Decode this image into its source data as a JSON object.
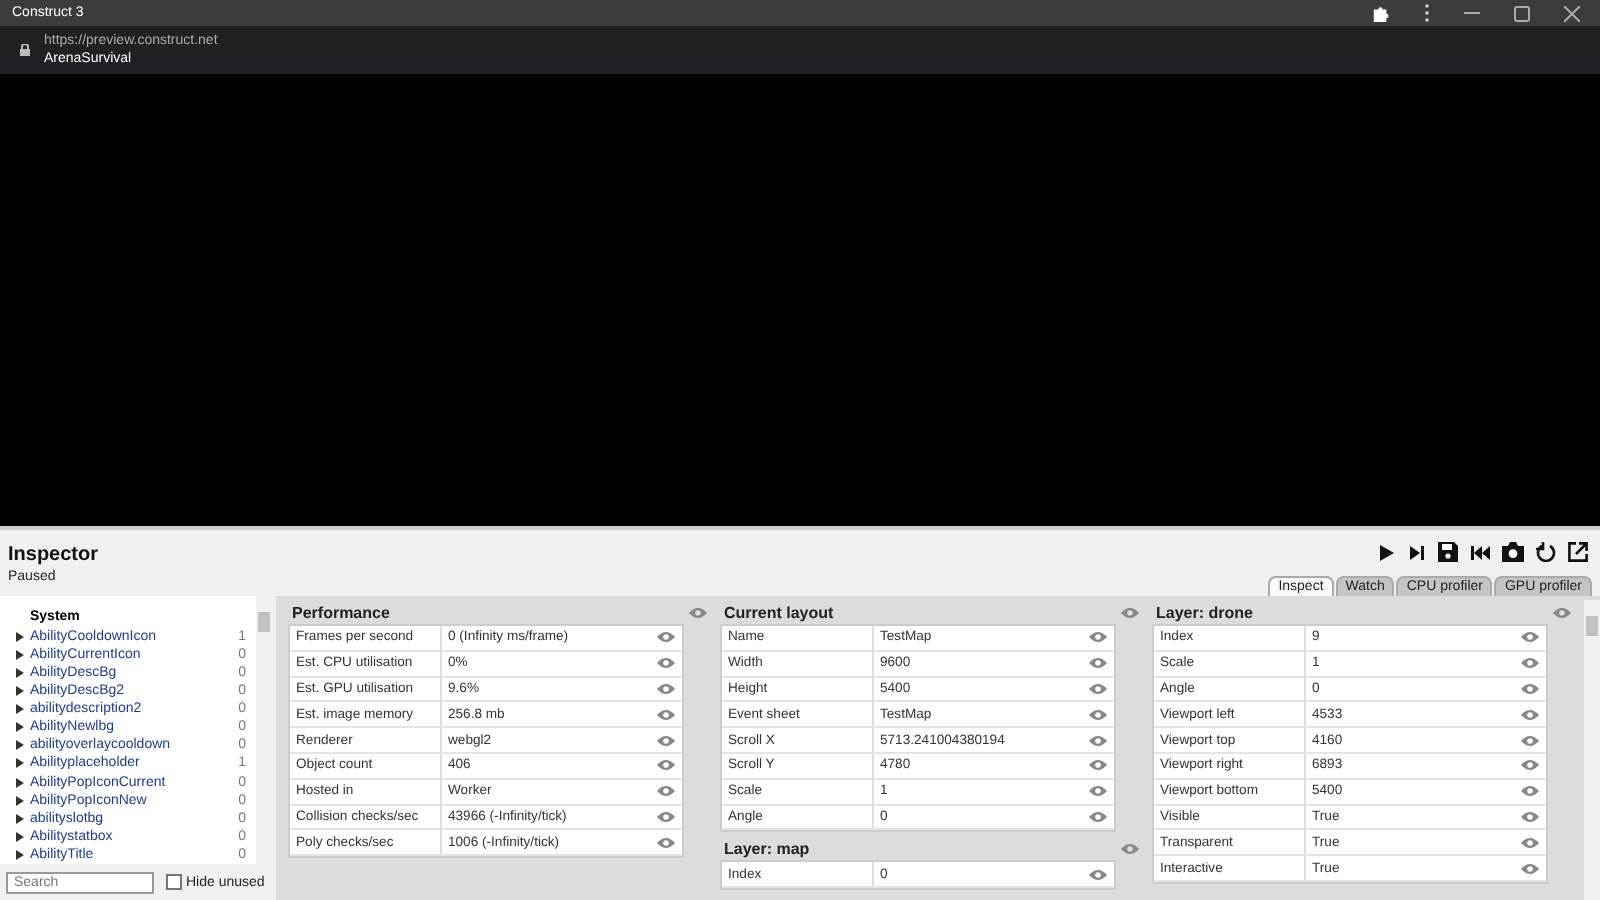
{
  "window": {
    "title": "Construct 3"
  },
  "address_bar": {
    "url": "https://preview.construct.net",
    "page_title": "ArenaSurvival"
  },
  "inspector": {
    "title": "Inspector",
    "status": "Paused",
    "toolbar": [
      {
        "kind": "play"
      },
      {
        "kind": "step"
      },
      {
        "kind": "save"
      },
      {
        "kind": "rewind"
      },
      {
        "kind": "camera"
      },
      {
        "kind": "restart"
      },
      {
        "kind": "popout"
      }
    ],
    "tabs": [
      {
        "label": "Inspect",
        "selected": true
      },
      {
        "label": "Watch",
        "selected": false
      },
      {
        "label": "CPU profiler",
        "selected": false
      },
      {
        "label": "GPU profiler",
        "selected": false
      }
    ],
    "tree": {
      "root": "System",
      "items": [
        {
          "name": "AbilityCooldownIcon",
          "count": "1"
        },
        {
          "name": "AbilityCurrentIcon",
          "count": "0"
        },
        {
          "name": "AbilityDescBg",
          "count": "0"
        },
        {
          "name": "AbilityDescBg2",
          "count": "0"
        },
        {
          "name": "abilitydescription2",
          "count": "0"
        },
        {
          "name": "AbilityNewlbg",
          "count": "0"
        },
        {
          "name": "abilityoverlaycooldown",
          "count": "0"
        },
        {
          "name": "Abilityplaceholder",
          "count": "1"
        },
        {
          "name": "AbilityPopIconCurrent",
          "count": "0"
        },
        {
          "name": "AbilityPopIconNew",
          "count": "0"
        },
        {
          "name": "abilityslotbg",
          "count": "0"
        },
        {
          "name": "Abilitystatbox",
          "count": "0"
        },
        {
          "name": "AbilityTitle",
          "count": "0"
        }
      ]
    },
    "search": {
      "placeholder": "Search"
    },
    "hide_unused": {
      "label": "Hide unused",
      "checked": false
    },
    "columns": [
      [
        {
          "heading": "Performance",
          "rows": [
            {
              "label": "Frames per second",
              "value": "0 (Infinity ms/frame)"
            },
            {
              "label": "Est. CPU utilisation",
              "value": "0%"
            },
            {
              "label": "Est. GPU utilisation",
              "value": "9.6%"
            },
            {
              "label": "Est. image memory",
              "value": "256.8 mb"
            },
            {
              "label": "Renderer",
              "value": "webgl2"
            },
            {
              "label": "Object count",
              "value": "406"
            },
            {
              "label": "Hosted in",
              "value": "Worker"
            },
            {
              "label": "Collision checks/sec",
              "value": "43966 (-Infinity/tick)"
            },
            {
              "label": "Poly checks/sec",
              "value": "1006 (-Infinity/tick)"
            }
          ]
        }
      ],
      [
        {
          "heading": "Current layout",
          "rows": [
            {
              "label": "Name",
              "value": "TestMap"
            },
            {
              "label": "Width",
              "value": "9600"
            },
            {
              "label": "Height",
              "value": "5400"
            },
            {
              "label": "Event sheet",
              "value": "TestMap"
            },
            {
              "label": "Scroll X",
              "value": "5713.241004380194"
            },
            {
              "label": "Scroll Y",
              "value": "4780"
            },
            {
              "label": "Scale",
              "value": "1"
            },
            {
              "label": "Angle",
              "value": "0"
            }
          ]
        },
        {
          "heading": "Layer: map",
          "rows": [
            {
              "label": "Index",
              "value": "0"
            }
          ]
        }
      ],
      [
        {
          "heading": "Layer: drone",
          "rows": [
            {
              "label": "Index",
              "value": "9"
            },
            {
              "label": "Scale",
              "value": "1"
            },
            {
              "label": "Angle",
              "value": "0"
            },
            {
              "label": "Viewport left",
              "value": "4533"
            },
            {
              "label": "Viewport top",
              "value": "4160"
            },
            {
              "label": "Viewport right",
              "value": "6893"
            },
            {
              "label": "Viewport bottom",
              "value": "5400"
            },
            {
              "label": "Visible",
              "value": "True"
            },
            {
              "label": "Transparent",
              "value": "True"
            },
            {
              "label": "Interactive",
              "value": "True"
            }
          ]
        }
      ]
    ]
  }
}
